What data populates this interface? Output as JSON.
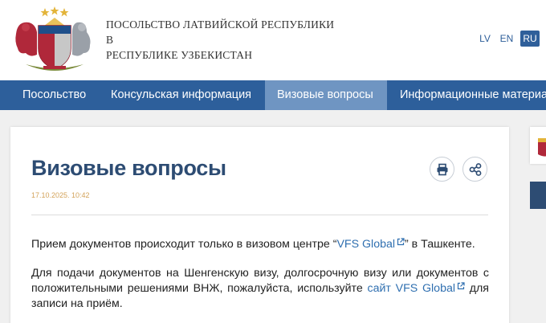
{
  "header": {
    "title_lines": [
      "Посольство Латвийской Республики",
      "в",
      "Республике Узбекистан"
    ]
  },
  "languages": {
    "lv": "LV",
    "en": "EN",
    "ru": "RU",
    "active": "RU"
  },
  "nav": {
    "items": [
      {
        "label": "Посольство"
      },
      {
        "label": "Консульская информация"
      },
      {
        "label": "Визовые вопросы",
        "active": true
      },
      {
        "label": "Информационные материа"
      }
    ]
  },
  "page": {
    "title": "Визовые вопросы",
    "date": "17.10.2025. 10:42",
    "p1": {
      "before": "Прием документов происходит только в визовом центре “",
      "link": "VFS Global",
      "after": "” в Ташкенте."
    },
    "p2": {
      "before": "Для подачи документов на Шенгенскую визу, долгосрочную визу или документов с положительными решениями ВНЖ, пожалуйста, используйте ",
      "link": "сайт VFS Global",
      "after": " для записи на приём."
    }
  },
  "colors": {
    "nav": "#2d5f9b",
    "nav_active": "#6f95c2",
    "title": "#2d4c73",
    "date": "#d3a35a",
    "link": "#2f6fb0"
  },
  "icons": {
    "coat_of_arms": "latvia-coat-of-arms-icon",
    "print": "print-icon",
    "share": "share-icon",
    "external": "external-link-icon"
  }
}
